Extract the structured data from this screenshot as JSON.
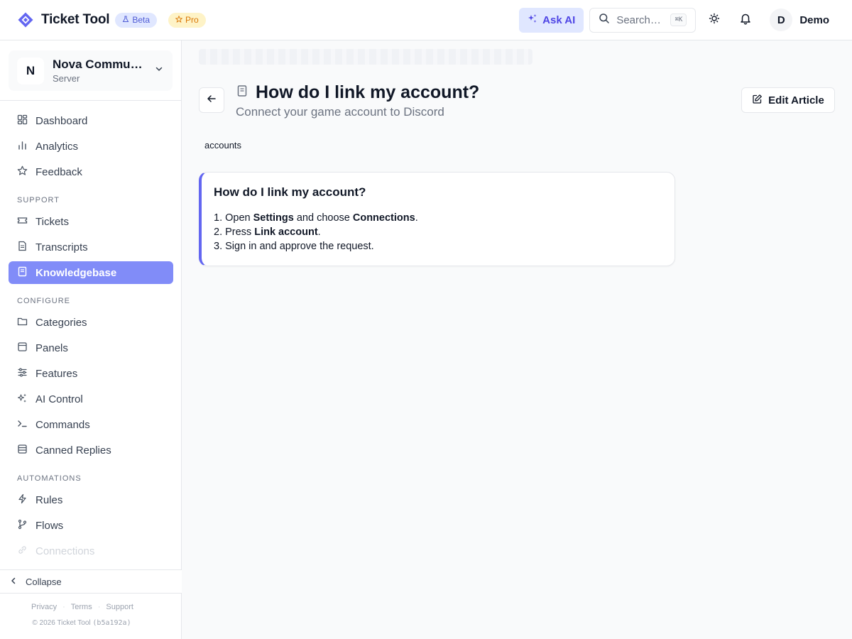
{
  "header": {
    "brand": "Ticket Tool",
    "beta_label": "Beta",
    "pro_label": "Pro",
    "ask_ai_label": "Ask AI",
    "search_placeholder": "Search…",
    "search_shortcut": "⌘K",
    "user_initial": "D",
    "user_name": "Demo"
  },
  "sidebar": {
    "server": {
      "initial": "N",
      "name": "Nova Community",
      "type": "Server"
    },
    "top_items": [
      {
        "label": "Dashboard",
        "icon": "dashboard-icon"
      },
      {
        "label": "Analytics",
        "icon": "chart-icon"
      },
      {
        "label": "Feedback",
        "icon": "star-icon"
      }
    ],
    "support_heading": "SUPPORT",
    "support_items": [
      {
        "label": "Tickets",
        "icon": "ticket-icon"
      },
      {
        "label": "Transcripts",
        "icon": "transcript-icon"
      },
      {
        "label": "Knowledgebase",
        "icon": "book-icon",
        "active": true
      }
    ],
    "configure_heading": "CONFIGURE",
    "configure_items": [
      {
        "label": "Categories",
        "icon": "folder-icon"
      },
      {
        "label": "Panels",
        "icon": "panel-icon"
      },
      {
        "label": "Features",
        "icon": "sliders-icon"
      },
      {
        "label": "AI Control",
        "icon": "sparkles-icon"
      },
      {
        "label": "Commands",
        "icon": "terminal-icon"
      },
      {
        "label": "Canned Replies",
        "icon": "list-icon"
      }
    ],
    "automations_heading": "AUTOMATIONS",
    "automations_items": [
      {
        "label": "Rules",
        "icon": "bolt-icon"
      },
      {
        "label": "Flows",
        "icon": "branch-icon"
      },
      {
        "label": "Connections",
        "icon": "link-icon"
      }
    ],
    "collapse_label": "Collapse",
    "footer": {
      "privacy": "Privacy",
      "terms": "Terms",
      "support": "Support",
      "copyright": "© 2026 Ticket Tool",
      "build_hash": "(b5a192a)"
    }
  },
  "main": {
    "page_title": "How do I link my account?",
    "page_subtitle": "Connect your game account to Discord",
    "edit_label": "Edit Article",
    "tag": "accounts",
    "article": {
      "title": "How do I link my account?",
      "step1": {
        "prefix": "1. Open ",
        "bold1": "Settings",
        "middle": " and choose ",
        "bold2": "Connections",
        "suffix": "."
      },
      "step2": {
        "prefix": "2. Press ",
        "bold1": "Link account",
        "suffix": "."
      },
      "step3": "3. Sign in and approve the request."
    }
  },
  "colors": {
    "accent": "#6366f1",
    "active_nav": "#818cf8",
    "beta_bg": "#e0e7ff",
    "pro_bg": "#fef3c7"
  }
}
